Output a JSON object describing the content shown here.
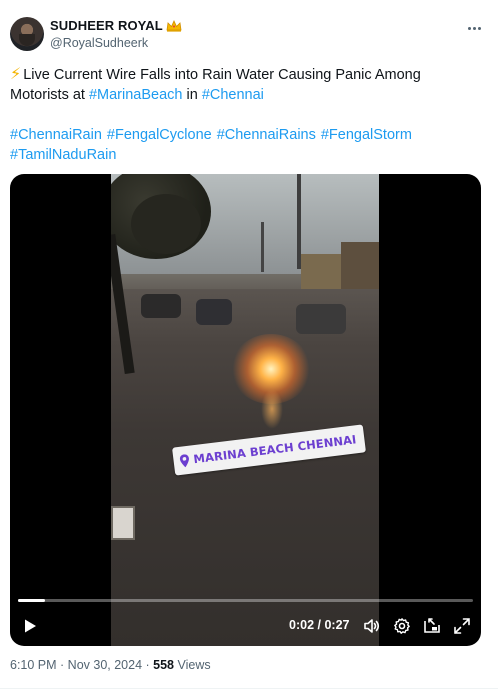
{
  "author": {
    "display_name": "SUDHEER ROYAL",
    "handle": "@RoyalSudheerk",
    "emoji_icon": "crown-icon"
  },
  "tweet": {
    "emoji_icon": "high-voltage-icon",
    "line1": "Live Current Wire Falls into Rain Water Causing Panic Among",
    "line2_prefix": "Motorists at ",
    "mention1": "#MarinaBeach",
    "line2_middle": " in ",
    "mention2": "#Chennai",
    "hashtags": [
      "#ChennaiRain",
      "#FengalCyclone",
      "#ChennaiRains",
      "#FengalStorm",
      "#TamilNaduRain"
    ]
  },
  "video": {
    "location_sticker": "MARINA BEACH CHENNAI",
    "time_current": "0:02",
    "time_total": "0:27",
    "time_separator": " / ",
    "progress_fraction": 0.06
  },
  "meta": {
    "time": "6:10 PM",
    "separator": " · ",
    "date": "Nov 30, 2024",
    "views": "558",
    "views_label": " Views"
  },
  "colors": {
    "link": "#1d9bf0",
    "secondary_text": "#536471",
    "primary_text": "#0f1419",
    "sticker_text": "#6c3fd0"
  }
}
